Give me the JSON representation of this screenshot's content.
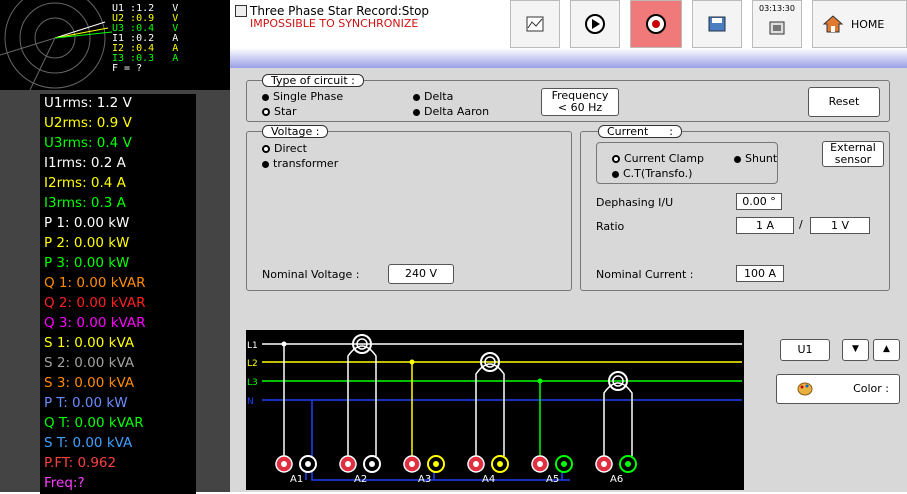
{
  "phasor": {
    "lines": [
      "U1 :1.2   V",
      "U2 :0.9   V",
      "U3 :0.4   V",
      "I1 :0.2   A",
      "I2 :0.4   A",
      "I3 :0.3   A",
      "F = ?"
    ],
    "colors": [
      "#ffffff",
      "#ffff00",
      "#00ff00",
      "#ffffff",
      "#ffff00",
      "#00ff00",
      "#ffffff"
    ]
  },
  "measurements": [
    {
      "text": "U1rms: 1.2 V",
      "color": "#ffffff"
    },
    {
      "text": "U2rms: 0.9 V",
      "color": "#ffff00"
    },
    {
      "text": "U3rms: 0.4 V",
      "color": "#00ff00"
    },
    {
      "text": "I1rms: 0.2 A",
      "color": "#ffffff"
    },
    {
      "text": "I2rms: 0.4 A",
      "color": "#ffff00"
    },
    {
      "text": "I3rms: 0.3 A",
      "color": "#00ff00"
    },
    {
      "text": "P 1: 0.00 kW",
      "color": "#ffffff"
    },
    {
      "text": "P 2: 0.00 kW",
      "color": "#ffff00"
    },
    {
      "text": "P 3: 0.00 kW",
      "color": "#00ff00"
    },
    {
      "text": "Q 1: 0.00 kVAR",
      "color": "#ff8c00"
    },
    {
      "text": "Q 2: 0.00 kVAR",
      "color": "#ff2020"
    },
    {
      "text": "Q 3: 0.00 kVAR",
      "color": "#ff00ff"
    },
    {
      "text": "S 1: 0.00 kVA",
      "color": "#ffff00"
    },
    {
      "text": "S 2: 0.00 kVA",
      "color": "#a0a0a0"
    },
    {
      "text": "S 3: 0.00 kVA",
      "color": "#ff8c00"
    },
    {
      "text": "P T: 0.00 kW",
      "color": "#6a8cff"
    },
    {
      "text": "Q T: 0.00 kVAR",
      "color": "#00ff00"
    },
    {
      "text": "S T: 0.00 kVA",
      "color": "#40a0ff"
    },
    {
      "text": "P.FT: 0.962",
      "color": "#ff4040"
    },
    {
      "text": "Freq:?",
      "color": "#ff40ff"
    }
  ],
  "header": {
    "title": "Three Phase Star Record:Stop",
    "status": "IMPOSSIBLE TO SYNCHRONIZE",
    "clock": "03:13:30",
    "home_label": "HOME"
  },
  "circuit": {
    "title": "Type of circuit :",
    "options": [
      "Single Phase",
      "Star",
      "Delta",
      "Delta Aaron"
    ],
    "selected": "Star",
    "frequency_label": "Frequency\n< 60 Hz",
    "reset_label": "Reset"
  },
  "voltage": {
    "title": "Voltage :",
    "options": [
      "Direct",
      "transformer"
    ],
    "selected": "Direct",
    "nominal_label": "Nominal Voltage :",
    "nominal_value": "240 V"
  },
  "current": {
    "title": "Current      :",
    "options": [
      "Current Clamp",
      "Shunt",
      "C.T(Transfo.)"
    ],
    "selected": "Current Clamp",
    "external_label": "External\nsensor",
    "dephasing_label": "Dephasing I/U",
    "dephasing_value": "0.00 °",
    "ratio_label": "Ratio",
    "ratio_a": "1 A",
    "ratio_sep": "/",
    "ratio_v": "1 V",
    "nominal_label": "Nominal Current :",
    "nominal_value": "100 A"
  },
  "wiring": {
    "lines": [
      "L1",
      "L2",
      "L3",
      "N"
    ],
    "line_colors": [
      "#ffffff",
      "#ffff00",
      "#00ff00",
      "#2040ff"
    ],
    "terminals": [
      "A1",
      "A2",
      "A3",
      "A4",
      "A5",
      "A6"
    ]
  },
  "channel": {
    "selected": "U1",
    "color_label": "Color :"
  }
}
